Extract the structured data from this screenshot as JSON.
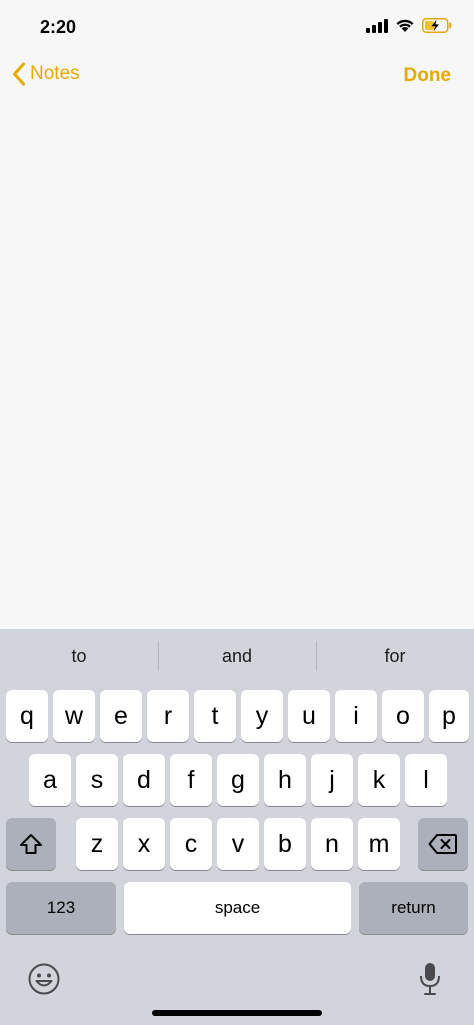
{
  "status_bar": {
    "time": "2:20",
    "icons": [
      "cellular-signal-icon",
      "wifi-icon",
      "battery-charging-icon"
    ]
  },
  "nav": {
    "back_label": "Notes",
    "done_label": "Done",
    "accent_color": "#e5a900"
  },
  "keyboard": {
    "suggestions": [
      "to",
      "and",
      "for"
    ],
    "rows": [
      [
        "q",
        "w",
        "e",
        "r",
        "t",
        "y",
        "u",
        "i",
        "o",
        "p"
      ],
      [
        "a",
        "s",
        "d",
        "f",
        "g",
        "h",
        "j",
        "k",
        "l"
      ],
      [
        "z",
        "x",
        "c",
        "v",
        "b",
        "n",
        "m"
      ]
    ],
    "numbers_label": "123",
    "space_label": "space",
    "return_label": "return",
    "icons": [
      "shift-icon",
      "delete-icon",
      "emoji-icon",
      "microphone-icon"
    ]
  }
}
